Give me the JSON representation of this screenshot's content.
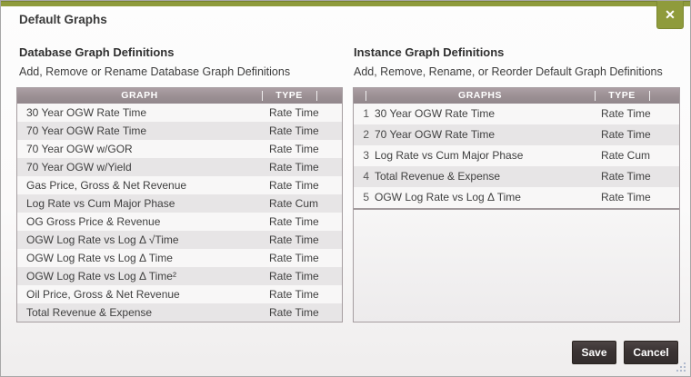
{
  "dialog": {
    "title": "Default Graphs"
  },
  "icons": {
    "close_glyph": "✕"
  },
  "database_section": {
    "heading": "Database Graph Definitions",
    "subtitle": "Add, Remove or Rename Database Graph Definitions",
    "table": {
      "columns": {
        "graph": "GRAPH",
        "type": "TYPE"
      },
      "rows": [
        {
          "name": "30 Year OGW Rate Time",
          "type": "Rate Time"
        },
        {
          "name": "70 Year OGW Rate Time",
          "type": "Rate Time"
        },
        {
          "name": "70 Year OGW w/GOR",
          "type": "Rate Time"
        },
        {
          "name": "70 Year OGW w/Yield",
          "type": "Rate Time"
        },
        {
          "name": "Gas Price, Gross & Net Revenue",
          "type": "Rate Time"
        },
        {
          "name": "Log Rate vs Cum Major Phase",
          "type": "Rate Cum"
        },
        {
          "name": "OG Gross Price & Revenue",
          "type": "Rate Time"
        },
        {
          "name": "OGW Log Rate vs Log Δ √Time",
          "type": "Rate Time"
        },
        {
          "name": "OGW Log Rate vs Log Δ Time",
          "type": "Rate Time"
        },
        {
          "name": "OGW Log Rate vs Log Δ Time²",
          "type": "Rate Time"
        },
        {
          "name": "Oil Price, Gross & Net Revenue",
          "type": "Rate Time"
        },
        {
          "name": "Total Revenue & Expense",
          "type": "Rate Time"
        }
      ]
    }
  },
  "instance_section": {
    "heading": "Instance Graph Definitions",
    "subtitle": "Add, Remove, Rename, or Reorder Default Graph Definitions",
    "table": {
      "columns": {
        "graph": "GRAPHS",
        "type": "TYPE"
      },
      "rows": [
        {
          "num": "1",
          "name": "30 Year OGW Rate Time",
          "type": "Rate Time"
        },
        {
          "num": "2",
          "name": "70 Year OGW Rate Time",
          "type": "Rate Time"
        },
        {
          "num": "3",
          "name": "Log Rate vs Cum Major Phase",
          "type": "Rate Cum"
        },
        {
          "num": "4",
          "name": "Total Revenue & Expense",
          "type": "Rate Time"
        },
        {
          "num": "5",
          "name": "OGW Log Rate vs Log Δ Time",
          "type": "Rate Time"
        }
      ]
    }
  },
  "footer": {
    "save_label": "Save",
    "cancel_label": "Cancel"
  },
  "colors": {
    "accent_green": "#8f9b3c",
    "table_header_mauve": "#9a8f93",
    "row_alt_gray": "#e7e5e6",
    "button_dark": "#3a3333",
    "table_border": "#a59da0"
  }
}
